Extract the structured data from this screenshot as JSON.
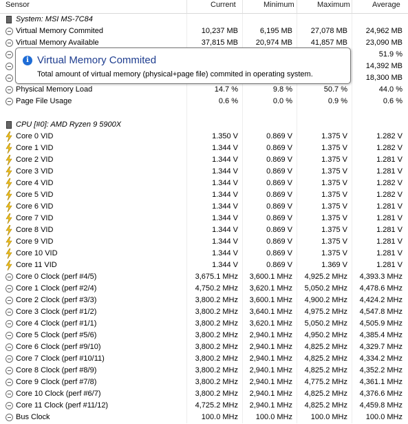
{
  "headers": {
    "sensor": "Sensor",
    "current": "Current",
    "minimum": "Minimum",
    "maximum": "Maximum",
    "average": "Average"
  },
  "tooltip": {
    "title": "Virtual Memory Commited",
    "body": "Total amount of virtual memory (physical+page file) commited in operating system.",
    "icon": "info-icon"
  },
  "rows": [
    {
      "type": "section",
      "icon": "chip",
      "name": "System: MSI MS-7C84",
      "cur": "",
      "min": "",
      "max": "",
      "avg": ""
    },
    {
      "type": "data",
      "icon": "clock",
      "name": "Virtual Memory Commited",
      "cur": "10,237 MB",
      "min": "6,195 MB",
      "max": "27,078 MB",
      "avg": "24,962 MB"
    },
    {
      "type": "data",
      "icon": "clock",
      "name": "Virtual Memory Available",
      "cur": "37,815 MB",
      "min": "20,974 MB",
      "max": "41,857 MB",
      "avg": "23,090 MB"
    },
    {
      "type": "data",
      "icon": "clock",
      "name": "",
      "cur": "",
      "min": "",
      "max": "",
      "avg": "51.9 %"
    },
    {
      "type": "data",
      "icon": "clock",
      "name": "",
      "cur": "",
      "min": "",
      "max": "",
      "avg": "14,392 MB"
    },
    {
      "type": "data",
      "icon": "clock",
      "name": "",
      "cur": "",
      "min": "",
      "max": "",
      "avg": "18,300 MB"
    },
    {
      "type": "data",
      "icon": "clock",
      "name": "Physical Memory Load",
      "cur": "14.7 %",
      "min": "9.8 %",
      "max": "50.7 %",
      "avg": "44.0 %"
    },
    {
      "type": "data",
      "icon": "clock",
      "name": "Page File Usage",
      "cur": "0.6 %",
      "min": "0.0 %",
      "max": "0.9 %",
      "avg": "0.6 %"
    },
    {
      "type": "blank",
      "icon": "",
      "name": "",
      "cur": "",
      "min": "",
      "max": "",
      "avg": ""
    },
    {
      "type": "section",
      "icon": "chip",
      "name": "CPU [#0]: AMD Ryzen 9 5900X",
      "cur": "",
      "min": "",
      "max": "",
      "avg": ""
    },
    {
      "type": "data",
      "icon": "bolt",
      "name": "Core 0 VID",
      "cur": "1.350 V",
      "min": "0.869 V",
      "max": "1.375 V",
      "avg": "1.282 V"
    },
    {
      "type": "data",
      "icon": "bolt",
      "name": "Core 1 VID",
      "cur": "1.344 V",
      "min": "0.869 V",
      "max": "1.375 V",
      "avg": "1.282 V"
    },
    {
      "type": "data",
      "icon": "bolt",
      "name": "Core 2 VID",
      "cur": "1.344 V",
      "min": "0.869 V",
      "max": "1.375 V",
      "avg": "1.281 V"
    },
    {
      "type": "data",
      "icon": "bolt",
      "name": "Core 3 VID",
      "cur": "1.344 V",
      "min": "0.869 V",
      "max": "1.375 V",
      "avg": "1.281 V"
    },
    {
      "type": "data",
      "icon": "bolt",
      "name": "Core 4 VID",
      "cur": "1.344 V",
      "min": "0.869 V",
      "max": "1.375 V",
      "avg": "1.282 V"
    },
    {
      "type": "data",
      "icon": "bolt",
      "name": "Core 5 VID",
      "cur": "1.344 V",
      "min": "0.869 V",
      "max": "1.375 V",
      "avg": "1.282 V"
    },
    {
      "type": "data",
      "icon": "bolt",
      "name": "Core 6 VID",
      "cur": "1.344 V",
      "min": "0.869 V",
      "max": "1.375 V",
      "avg": "1.281 V"
    },
    {
      "type": "data",
      "icon": "bolt",
      "name": "Core 7 VID",
      "cur": "1.344 V",
      "min": "0.869 V",
      "max": "1.375 V",
      "avg": "1.281 V"
    },
    {
      "type": "data",
      "icon": "bolt",
      "name": "Core 8 VID",
      "cur": "1.344 V",
      "min": "0.869 V",
      "max": "1.375 V",
      "avg": "1.281 V"
    },
    {
      "type": "data",
      "icon": "bolt",
      "name": "Core 9 VID",
      "cur": "1.344 V",
      "min": "0.869 V",
      "max": "1.375 V",
      "avg": "1.281 V"
    },
    {
      "type": "data",
      "icon": "bolt",
      "name": "Core 10 VID",
      "cur": "1.344 V",
      "min": "0.869 V",
      "max": "1.375 V",
      "avg": "1.281 V"
    },
    {
      "type": "data",
      "icon": "bolt",
      "name": "Core 11 VID",
      "cur": "1.344 V",
      "min": "0.869 V",
      "max": "1.369 V",
      "avg": "1.281 V"
    },
    {
      "type": "data",
      "icon": "clock",
      "name": "Core 0 Clock (perf #4/5)",
      "cur": "3,675.1 MHz",
      "min": "3,600.1 MHz",
      "max": "4,925.2 MHz",
      "avg": "4,393.3 MHz"
    },
    {
      "type": "data",
      "icon": "clock",
      "name": "Core 1 Clock (perf #2/4)",
      "cur": "4,750.2 MHz",
      "min": "3,620.1 MHz",
      "max": "5,050.2 MHz",
      "avg": "4,478.6 MHz"
    },
    {
      "type": "data",
      "icon": "clock",
      "name": "Core 2 Clock (perf #3/3)",
      "cur": "3,800.2 MHz",
      "min": "3,600.1 MHz",
      "max": "4,900.2 MHz",
      "avg": "4,424.2 MHz"
    },
    {
      "type": "data",
      "icon": "clock",
      "name": "Core 3 Clock (perf #1/2)",
      "cur": "3,800.2 MHz",
      "min": "3,640.1 MHz",
      "max": "4,975.2 MHz",
      "avg": "4,547.8 MHz"
    },
    {
      "type": "data",
      "icon": "clock",
      "name": "Core 4 Clock (perf #1/1)",
      "cur": "3,800.2 MHz",
      "min": "3,620.1 MHz",
      "max": "5,050.2 MHz",
      "avg": "4,505.9 MHz"
    },
    {
      "type": "data",
      "icon": "clock",
      "name": "Core 5 Clock (perf #5/6)",
      "cur": "3,800.2 MHz",
      "min": "2,940.1 MHz",
      "max": "4,950.2 MHz",
      "avg": "4,385.4 MHz"
    },
    {
      "type": "data",
      "icon": "clock",
      "name": "Core 6 Clock (perf #9/10)",
      "cur": "3,800.2 MHz",
      "min": "2,940.1 MHz",
      "max": "4,825.2 MHz",
      "avg": "4,329.7 MHz"
    },
    {
      "type": "data",
      "icon": "clock",
      "name": "Core 7 Clock (perf #10/11)",
      "cur": "3,800.2 MHz",
      "min": "2,940.1 MHz",
      "max": "4,825.2 MHz",
      "avg": "4,334.2 MHz"
    },
    {
      "type": "data",
      "icon": "clock",
      "name": "Core 8 Clock (perf #8/9)",
      "cur": "3,800.2 MHz",
      "min": "2,940.1 MHz",
      "max": "4,825.2 MHz",
      "avg": "4,352.2 MHz"
    },
    {
      "type": "data",
      "icon": "clock",
      "name": "Core 9 Clock (perf #7/8)",
      "cur": "3,800.2 MHz",
      "min": "2,940.1 MHz",
      "max": "4,775.2 MHz",
      "avg": "4,361.1 MHz"
    },
    {
      "type": "data",
      "icon": "clock",
      "name": "Core 10 Clock (perf #6/7)",
      "cur": "3,800.2 MHz",
      "min": "2,940.1 MHz",
      "max": "4,825.2 MHz",
      "avg": "4,376.6 MHz"
    },
    {
      "type": "data",
      "icon": "clock",
      "name": "Core 11 Clock (perf #11/12)",
      "cur": "4,725.2 MHz",
      "min": "2,940.1 MHz",
      "max": "4,825.2 MHz",
      "avg": "4,459.8 MHz"
    },
    {
      "type": "data",
      "icon": "clock",
      "name": "Bus Clock",
      "cur": "100.0 MHz",
      "min": "100.0 MHz",
      "max": "100.0 MHz",
      "avg": "100.0 MHz"
    }
  ]
}
